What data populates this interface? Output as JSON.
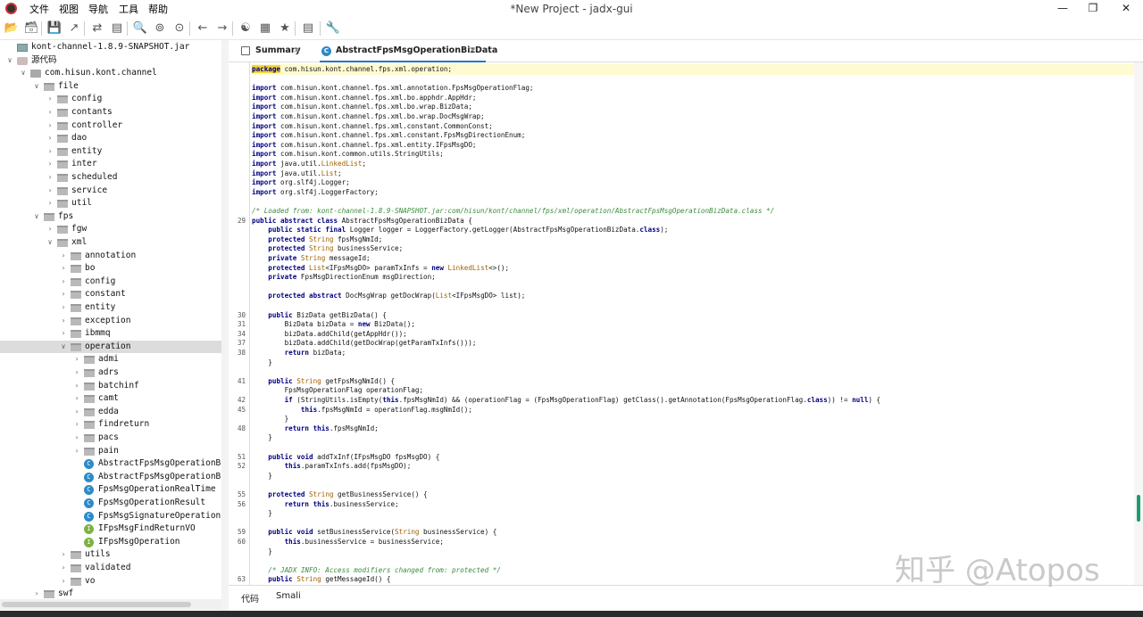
{
  "window": {
    "title": "*New Project - jadx-gui"
  },
  "menu": [
    "文件",
    "视图",
    "导航",
    "工具",
    "帮助"
  ],
  "tree": {
    "rows": [
      {
        "label": "kont-channel-1.8.9-SNAPSHOT.jar",
        "icon": "jar-icon",
        "level": 0,
        "expand": "none"
      },
      {
        "label": "源代码",
        "icon": "source-folder-icon",
        "level": 0,
        "expand": "open"
      },
      {
        "label": "com.hisun.kont.channel",
        "icon": "package-icon",
        "level": 1,
        "expand": "open"
      },
      {
        "label": "file",
        "icon": "folder-icon",
        "level": 2,
        "expand": "open"
      },
      {
        "label": "config",
        "icon": "folder-icon",
        "level": 3,
        "expand": "closed"
      },
      {
        "label": "contants",
        "icon": "folder-icon",
        "level": 3,
        "expand": "closed"
      },
      {
        "label": "controller",
        "icon": "folder-icon",
        "level": 3,
        "expand": "closed"
      },
      {
        "label": "dao",
        "icon": "folder-icon",
        "level": 3,
        "expand": "closed"
      },
      {
        "label": "entity",
        "icon": "folder-icon",
        "level": 3,
        "expand": "closed"
      },
      {
        "label": "inter",
        "icon": "folder-icon",
        "level": 3,
        "expand": "closed"
      },
      {
        "label": "scheduled",
        "icon": "folder-icon",
        "level": 3,
        "expand": "closed"
      },
      {
        "label": "service",
        "icon": "folder-icon",
        "level": 3,
        "expand": "closed"
      },
      {
        "label": "util",
        "icon": "folder-icon",
        "level": 3,
        "expand": "closed"
      },
      {
        "label": "fps",
        "icon": "folder-icon",
        "level": 2,
        "expand": "open"
      },
      {
        "label": "fgw",
        "icon": "folder-icon",
        "level": 3,
        "expand": "closed"
      },
      {
        "label": "xml",
        "icon": "folder-icon",
        "level": 3,
        "expand": "open"
      },
      {
        "label": "annotation",
        "icon": "folder-icon",
        "level": 4,
        "expand": "closed"
      },
      {
        "label": "bo",
        "icon": "folder-icon",
        "level": 4,
        "expand": "closed"
      },
      {
        "label": "config",
        "icon": "folder-icon",
        "level": 4,
        "expand": "closed"
      },
      {
        "label": "constant",
        "icon": "folder-icon",
        "level": 4,
        "expand": "closed"
      },
      {
        "label": "entity",
        "icon": "folder-icon",
        "level": 4,
        "expand": "closed"
      },
      {
        "label": "exception",
        "icon": "folder-icon",
        "level": 4,
        "expand": "closed"
      },
      {
        "label": "ibmmq",
        "icon": "folder-icon",
        "level": 4,
        "expand": "closed"
      },
      {
        "label": "operation",
        "icon": "folder-icon",
        "level": 4,
        "expand": "open",
        "selected": true
      },
      {
        "label": "admi",
        "icon": "folder-icon",
        "level": 5,
        "expand": "closed"
      },
      {
        "label": "adrs",
        "icon": "folder-icon",
        "level": 5,
        "expand": "closed"
      },
      {
        "label": "batchinf",
        "icon": "folder-icon",
        "level": 5,
        "expand": "closed"
      },
      {
        "label": "camt",
        "icon": "folder-icon",
        "level": 5,
        "expand": "closed"
      },
      {
        "label": "edda",
        "icon": "folder-icon",
        "level": 5,
        "expand": "closed"
      },
      {
        "label": "findreturn",
        "icon": "folder-icon",
        "level": 5,
        "expand": "closed"
      },
      {
        "label": "pacs",
        "icon": "folder-icon",
        "level": 5,
        "expand": "closed"
      },
      {
        "label": "pain",
        "icon": "folder-icon",
        "level": 5,
        "expand": "closed"
      },
      {
        "label": "AbstractFpsMsgOperationBa",
        "icon": "class-icon",
        "level": 5,
        "expand": "none"
      },
      {
        "label": "AbstractFpsMsgOperationBi",
        "icon": "class-icon",
        "level": 5,
        "expand": "none"
      },
      {
        "label": "FpsMsgOperationRealTime",
        "icon": "class-icon",
        "level": 5,
        "expand": "none"
      },
      {
        "label": "FpsMsgOperationResult",
        "icon": "class-icon",
        "level": 5,
        "expand": "none"
      },
      {
        "label": "FpsMsgSignatureOperation",
        "icon": "class-icon",
        "level": 5,
        "expand": "none"
      },
      {
        "label": "IFpsMsgFindReturnVO",
        "icon": "interface-icon",
        "level": 5,
        "expand": "none"
      },
      {
        "label": "IFpsMsgOperation",
        "icon": "interface-icon",
        "level": 5,
        "expand": "none"
      },
      {
        "label": "utils",
        "icon": "folder-icon",
        "level": 4,
        "expand": "closed"
      },
      {
        "label": "validated",
        "icon": "folder-icon",
        "level": 4,
        "expand": "closed"
      },
      {
        "label": "vo",
        "icon": "folder-icon",
        "level": 4,
        "expand": "closed"
      },
      {
        "label": "swf",
        "icon": "folder-icon",
        "level": 2,
        "expand": "closed"
      }
    ]
  },
  "tabs": [
    {
      "label": "Summary",
      "close": "×"
    },
    {
      "label": "AbstractFpsMsgOperationBizData",
      "close": "×"
    }
  ],
  "code": {
    "lines": [
      {
        "n": "",
        "t": "package com.hisun.kont.channel.fps.xml.operation;"
      },
      {
        "n": "",
        "t": ""
      },
      {
        "n": "",
        "t": "import com.hisun.kont.channel.fps.xml.annotation.FpsMsgOperationFlag;"
      },
      {
        "n": "",
        "t": "import com.hisun.kont.channel.fps.xml.bo.apphdr.AppHdr;"
      },
      {
        "n": "",
        "t": "import com.hisun.kont.channel.fps.xml.bo.wrap.BizData;"
      },
      {
        "n": "",
        "t": "import com.hisun.kont.channel.fps.xml.bo.wrap.DocMsgWrap;"
      },
      {
        "n": "",
        "t": "import com.hisun.kont.channel.fps.xml.constant.CommonConst;"
      },
      {
        "n": "",
        "t": "import com.hisun.kont.channel.fps.xml.constant.FpsMsgDirectionEnum;"
      },
      {
        "n": "",
        "t": "import com.hisun.kont.channel.fps.xml.entity.IFpsMsgDO;"
      },
      {
        "n": "",
        "t": "import com.hisun.kont.common.utils.StringUtils;"
      },
      {
        "n": "",
        "t": "import java.util.LinkedList;"
      },
      {
        "n": "",
        "t": "import java.util.List;"
      },
      {
        "n": "",
        "t": "import org.slf4j.Logger;"
      },
      {
        "n": "",
        "t": "import org.slf4j.LoggerFactory;"
      },
      {
        "n": "",
        "t": ""
      },
      {
        "n": "",
        "t": "/* Loaded from: kont-channel-1.8.9-SNAPSHOT.jar:com/hisun/kont/channel/fps/xml/operation/AbstractFpsMsgOperationBizData.class */"
      },
      {
        "n": "29",
        "t": "public abstract class AbstractFpsMsgOperationBizData {"
      },
      {
        "n": "",
        "t": "    public static final Logger logger = LoggerFactory.getLogger(AbstractFpsMsgOperationBizData.class);"
      },
      {
        "n": "",
        "t": "    protected String fpsMsgNmId;"
      },
      {
        "n": "",
        "t": "    protected String businessService;"
      },
      {
        "n": "",
        "t": "    private String messageId;"
      },
      {
        "n": "",
        "t": "    protected List<IFpsMsgDO> paramTxInfs = new LinkedList<>();"
      },
      {
        "n": "",
        "t": "    private FpsMsgDirectionEnum msgDirection;"
      },
      {
        "n": "",
        "t": ""
      },
      {
        "n": "",
        "t": "    protected abstract DocMsgWrap getDocWrap(List<IFpsMsgDO> list);"
      },
      {
        "n": "",
        "t": ""
      },
      {
        "n": "30",
        "t": "    public BizData getBizData() {"
      },
      {
        "n": "31",
        "t": "        BizData bizData = new BizData();"
      },
      {
        "n": "34",
        "t": "        bizData.addChild(getAppHdr());"
      },
      {
        "n": "37",
        "t": "        bizData.addChild(getDocWrap(getParamTxInfs()));"
      },
      {
        "n": "38",
        "t": "        return bizData;"
      },
      {
        "n": "",
        "t": "    }"
      },
      {
        "n": "",
        "t": ""
      },
      {
        "n": "41",
        "t": "    public String getFpsMsgNmId() {"
      },
      {
        "n": "",
        "t": "        FpsMsgOperationFlag operationFlag;"
      },
      {
        "n": "42",
        "t": "        if (StringUtils.isEmpty(this.fpsMsgNmId) && (operationFlag = (FpsMsgOperationFlag) getClass().getAnnotation(FpsMsgOperationFlag.class)) != null) {"
      },
      {
        "n": "45",
        "t": "            this.fpsMsgNmId = operationFlag.msgNmId();"
      },
      {
        "n": "",
        "t": "        }"
      },
      {
        "n": "48",
        "t": "        return this.fpsMsgNmId;"
      },
      {
        "n": "",
        "t": "    }"
      },
      {
        "n": "",
        "t": ""
      },
      {
        "n": "51",
        "t": "    public void addTxInf(IFpsMsgDO fpsMsgDO) {"
      },
      {
        "n": "52",
        "t": "        this.paramTxInfs.add(fpsMsgDO);"
      },
      {
        "n": "",
        "t": "    }"
      },
      {
        "n": "",
        "t": ""
      },
      {
        "n": "55",
        "t": "    protected String getBusinessService() {"
      },
      {
        "n": "56",
        "t": "        return this.businessService;"
      },
      {
        "n": "",
        "t": "    }"
      },
      {
        "n": "",
        "t": ""
      },
      {
        "n": "59",
        "t": "    public void setBusinessService(String businessService) {"
      },
      {
        "n": "60",
        "t": "        this.businessService = businessService;"
      },
      {
        "n": "",
        "t": "    }"
      },
      {
        "n": "",
        "t": ""
      },
      {
        "n": "",
        "t": "    /* JADX INFO: Access modifiers changed from: protected */"
      },
      {
        "n": "63",
        "t": "    public String getMessageId() {"
      }
    ]
  },
  "bottom_tabs": [
    "代码",
    "Smali"
  ],
  "watermark": "知乎 @Atopos"
}
